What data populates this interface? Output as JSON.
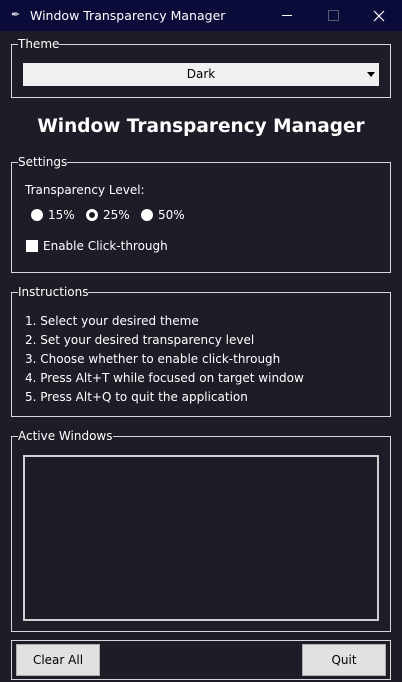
{
  "window": {
    "title": "Window Transparency Manager",
    "minimize_icon": "minimize-icon",
    "maximize_icon": "maximize-icon",
    "close_icon": "close-icon"
  },
  "theme_group": {
    "legend": "Theme",
    "selected": "Dark"
  },
  "heading": "Window Transparency Manager",
  "settings": {
    "legend": "Settings",
    "transparency_label": "Transparency Level:",
    "options": [
      {
        "label": "15%",
        "checked": false
      },
      {
        "label": "25%",
        "checked": true
      },
      {
        "label": "50%",
        "checked": false
      }
    ],
    "click_through_label": "Enable Click-through",
    "click_through_checked": false
  },
  "instructions": {
    "legend": "Instructions",
    "lines": [
      "1. Select your desired theme",
      "2. Set your desired transparency level",
      "3. Choose whether to enable click-through",
      "4. Press Alt+T while focused on target window",
      "5. Press Alt+Q to quit the application"
    ]
  },
  "active_windows": {
    "legend": "Active Windows",
    "items": []
  },
  "buttons": {
    "clear_all": "Clear All",
    "quit": "Quit"
  },
  "colors": {
    "background": "#1e1c26",
    "titlebar": "#0b0b3a",
    "border": "#d8d8d8",
    "button": "#e1e1e1"
  }
}
